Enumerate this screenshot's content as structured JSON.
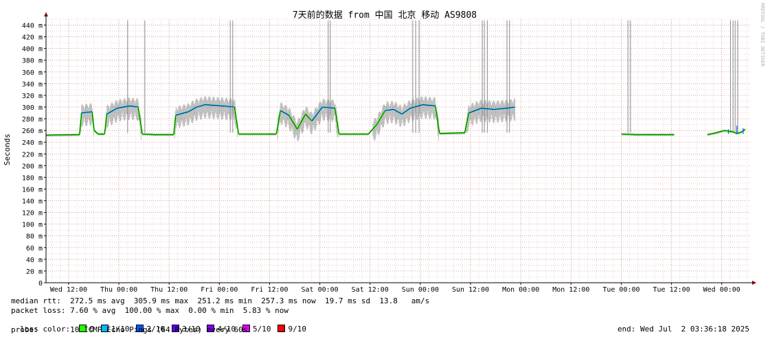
{
  "title": "7天前的数据 from 中国 北京 移动 AS9808",
  "watermark": "RRDTOOL / TOBI OETIKER",
  "colors": {
    "grid_minor": "#e8b4b4",
    "grid_major": "#d07070",
    "axis": "#800000",
    "median": "#000000",
    "smoke": "#4d4d4d"
  },
  "chart_data": {
    "type": "line",
    "title": "7天前的数据 from 中国 北京 移动 AS9808",
    "ylabel": "Seconds",
    "y_unit": "ms",
    "ylim": [
      0,
      450
    ],
    "y_ticks": [
      {
        "v": 0,
        "label": "0"
      },
      {
        "v": 20,
        "label": "20 m"
      },
      {
        "v": 40,
        "label": "40 m"
      },
      {
        "v": 60,
        "label": "60 m"
      },
      {
        "v": 80,
        "label": "80 m"
      },
      {
        "v": 100,
        "label": "100 m"
      },
      {
        "v": 120,
        "label": "120 m"
      },
      {
        "v": 140,
        "label": "140 m"
      },
      {
        "v": 160,
        "label": "160 m"
      },
      {
        "v": 180,
        "label": "180 m"
      },
      {
        "v": 200,
        "label": "200 m"
      },
      {
        "v": 220,
        "label": "220 m"
      },
      {
        "v": 240,
        "label": "240 m"
      },
      {
        "v": 260,
        "label": "260 m"
      },
      {
        "v": 280,
        "label": "280 m"
      },
      {
        "v": 300,
        "label": "300 m"
      },
      {
        "v": 320,
        "label": "320 m"
      },
      {
        "v": 340,
        "label": "340 m"
      },
      {
        "v": 360,
        "label": "360 m"
      },
      {
        "v": 380,
        "label": "380 m"
      },
      {
        "v": 400,
        "label": "400 m"
      },
      {
        "v": 420,
        "label": "420 m"
      },
      {
        "v": 440,
        "label": "440 m"
      }
    ],
    "xlim": [
      0,
      140.6
    ],
    "x_unit": "hours since plot start (Tue 06:36)",
    "x_ticks": [
      {
        "v": 5.4,
        "label": "Wed 12:00"
      },
      {
        "v": 17.4,
        "label": "Thu 00:00"
      },
      {
        "v": 29.4,
        "label": "Thu 12:00"
      },
      {
        "v": 41.4,
        "label": "Fri 00:00"
      },
      {
        "v": 53.4,
        "label": "Fri 12:00"
      },
      {
        "v": 65.4,
        "label": "Sat 00:00"
      },
      {
        "v": 77.4,
        "label": "Sat 12:00"
      },
      {
        "v": 89.4,
        "label": "Sun 00:00"
      },
      {
        "v": 101.4,
        "label": "Sun 12:00"
      },
      {
        "v": 113.4,
        "label": "Mon 00:00"
      },
      {
        "v": 125.4,
        "label": "Mon 12:00"
      },
      {
        "v": 137.4,
        "label": "Tue 00:00"
      },
      {
        "v": 149.4,
        "label": "Tue 12:00"
      },
      {
        "v": 161.4,
        "label": "Wed 00:00"
      }
    ],
    "median_segments": [
      {
        "name": "seg1",
        "points": [
          [
            0,
            252
          ],
          [
            8,
            253
          ],
          [
            8.5,
            290
          ],
          [
            11,
            292
          ],
          [
            11.5,
            260
          ],
          [
            12.5,
            254
          ],
          [
            14,
            254
          ],
          [
            14.5,
            288
          ],
          [
            17,
            298
          ],
          [
            20,
            302
          ],
          [
            22,
            300
          ],
          [
            23,
            254
          ],
          [
            26,
            253
          ],
          [
            30.5,
            253
          ],
          [
            31,
            286
          ],
          [
            34,
            292
          ],
          [
            36,
            300
          ],
          [
            38,
            304
          ],
          [
            42,
            302
          ],
          [
            45,
            300
          ],
          [
            46,
            254
          ],
          [
            53,
            254
          ],
          [
            55,
            254
          ],
          [
            56,
            294
          ],
          [
            58,
            286
          ],
          [
            60,
            262
          ],
          [
            62,
            288
          ],
          [
            63.5,
            276
          ],
          [
            66,
            300
          ],
          [
            69,
            298
          ],
          [
            70,
            254
          ],
          [
            77,
            254
          ],
          [
            79,
            270
          ],
          [
            81,
            294
          ],
          [
            83,
            296
          ],
          [
            85,
            288
          ],
          [
            87,
            298
          ],
          [
            90,
            304
          ],
          [
            93,
            302
          ],
          [
            94,
            255
          ],
          [
            100,
            256
          ],
          [
            101,
            290
          ],
          [
            104,
            298
          ],
          [
            107,
            296
          ],
          [
            110,
            298
          ],
          [
            112,
            300
          ]
        ]
      },
      {
        "name": "seg2",
        "points": [
          [
            137.5,
            254
          ],
          [
            141,
            253
          ],
          [
            150,
            253
          ]
        ]
      },
      {
        "name": "seg3",
        "points": [
          [
            158,
            253
          ],
          [
            160,
            256
          ],
          [
            162,
            260
          ],
          [
            164,
            258
          ],
          [
            165,
            255
          ],
          [
            166,
            257
          ],
          [
            167,
            262
          ]
        ]
      }
    ],
    "spikes": [
      19.5,
      23.6,
      44,
      44.6,
      67.4,
      67.9,
      87.6,
      88.3,
      89.1,
      104.2,
      104.7,
      105.4,
      110.1,
      110.7,
      139,
      139.6,
      163.5,
      164.1,
      164.6,
      165.2
    ],
    "loss_legend": [
      {
        "label": "0",
        "color": "#26ff00"
      },
      {
        "label": "1/10",
        "color": "#00b8ff"
      },
      {
        "label": "2/10",
        "color": "#0059ff"
      },
      {
        "label": "3/10",
        "color": "#5e00ff"
      },
      {
        "label": "4/10",
        "color": "#7e00ff"
      },
      {
        "label": "5/10",
        "color": "#dd00ff"
      },
      {
        "label": "9/10",
        "color": "#ff0000"
      }
    ]
  },
  "stats": {
    "median_rtt": "median rtt:  272.5 ms avg  305.9 ms max  251.2 ms min  257.3 ms now  19.7 ms sd  13.8   am/s",
    "packet_loss": "packet loss: 7.60 % avg  100.00 % max  0.00 % min  5.83 % now",
    "loss_color_label": "loss color:",
    "probe": "probe:       10 ICMP Echo Pings (64 Bytes) every 60s",
    "end": "end: Wed Jul  2 03:36:18 2025"
  }
}
